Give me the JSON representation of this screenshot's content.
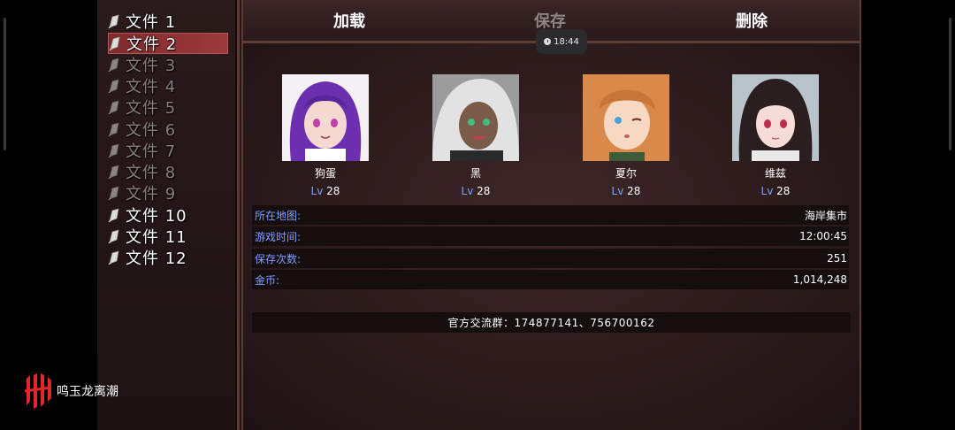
{
  "files": [
    {
      "label": "文件 1",
      "filled": true
    },
    {
      "label": "文件 2",
      "filled": true,
      "selected": true
    },
    {
      "label": "文件 3",
      "filled": false
    },
    {
      "label": "文件 4",
      "filled": false
    },
    {
      "label": "文件 5",
      "filled": false
    },
    {
      "label": "文件 6",
      "filled": false
    },
    {
      "label": "文件 7",
      "filled": false
    },
    {
      "label": "文件 8",
      "filled": false
    },
    {
      "label": "文件 9",
      "filled": false
    },
    {
      "label": "文件 10",
      "filled": true
    },
    {
      "label": "文件 11",
      "filled": true
    },
    {
      "label": "文件 12",
      "filled": true
    }
  ],
  "tabs": {
    "load": "加载",
    "save": "保存",
    "delete": "删除"
  },
  "clock": {
    "time": "18:44"
  },
  "party": [
    {
      "name": "狗蛋",
      "level_prefix": "Lv",
      "level": "28",
      "hair_color": "#6b2fb0"
    },
    {
      "name": "黑",
      "level_prefix": "Lv",
      "level": "28",
      "hair_color": "#d8d8d8"
    },
    {
      "name": "夏尔",
      "level_prefix": "Lv",
      "level": "28",
      "hair_color": "#d98a4a"
    },
    {
      "name": "维兹",
      "level_prefix": "Lv",
      "level": "28",
      "hair_color": "#2a1e1e"
    }
  ],
  "info": [
    {
      "key": "所在地图:",
      "value": "海岸集市"
    },
    {
      "key": "游戏时间:",
      "value": "12:00:45"
    },
    {
      "key": "保存次数:",
      "value": "251"
    },
    {
      "key": "金币:",
      "value": "1,014,248"
    }
  ],
  "notice": "官方交流群：174877141、756700162",
  "brand": {
    "text": "鸣玉龙离潮",
    "color": "#e4262c"
  },
  "colors": {
    "accent_blue": "#7da0ff",
    "selected_row": "#9b3a3a"
  }
}
